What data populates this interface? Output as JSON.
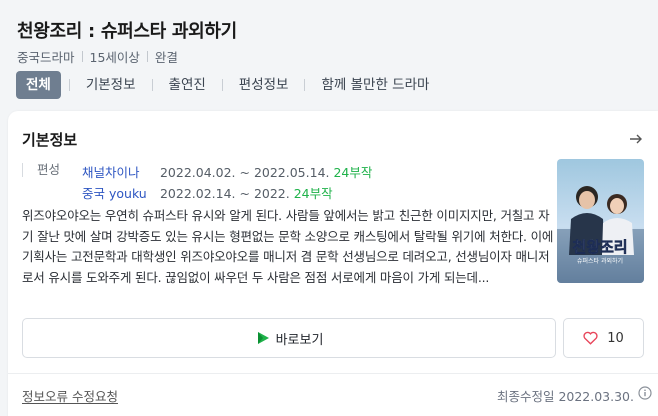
{
  "header": {
    "title": "천왕조리 : 슈퍼스타 과외하기",
    "meta": [
      "중국드라마",
      "15세이상",
      "완결"
    ]
  },
  "tabs": [
    "전체",
    "기본정보",
    "출연진",
    "편성정보",
    "함께 볼만한 드라마"
  ],
  "basic_info": {
    "title": "기본정보",
    "label": "편성",
    "broadcasts": [
      {
        "channel": "채널차이나",
        "dates": "2022.04.02. ~ 2022.05.14.",
        "episodes": "24부작"
      },
      {
        "channel": "중국 youku",
        "dates": "2022.02.14. ~ 2022.",
        "episodes": "24부작"
      }
    ],
    "synopsis": "위즈야오야오는 우연히 슈퍼스타 유시와 알게 된다. 사람들 앞에서는 밝고 친근한 이미지지만, 거칠고 자기 잘난 맛에 살며 강박증도 있는 유시는 형편없는 문학 소양으로 캐스팅에서 탈락될 위기에 처한다. 이에 기획사는 고전문학과 대학생인 위즈야오야오를 매니저 겸 문학 선생님으로 데려오고, 선생님이자 매니저로서 유시를 도와주게 된다. 끊임없이 싸우던 두 사람은 점점 서로에게 마음이 가게 되는데...",
    "poster_title": "천왕조리",
    "poster_subtitle": "슈퍼스타 과외하기",
    "watch_label": "바로보기",
    "like_count": "10",
    "report_label": "정보오류 수정요청",
    "updated": "최종수정일 2022.03.30."
  },
  "colors": {
    "accent_tab": "#6f7e90",
    "link_blue": "#2e56c2",
    "episode_green": "#1fb24a",
    "like_heart": "#e8455a"
  }
}
